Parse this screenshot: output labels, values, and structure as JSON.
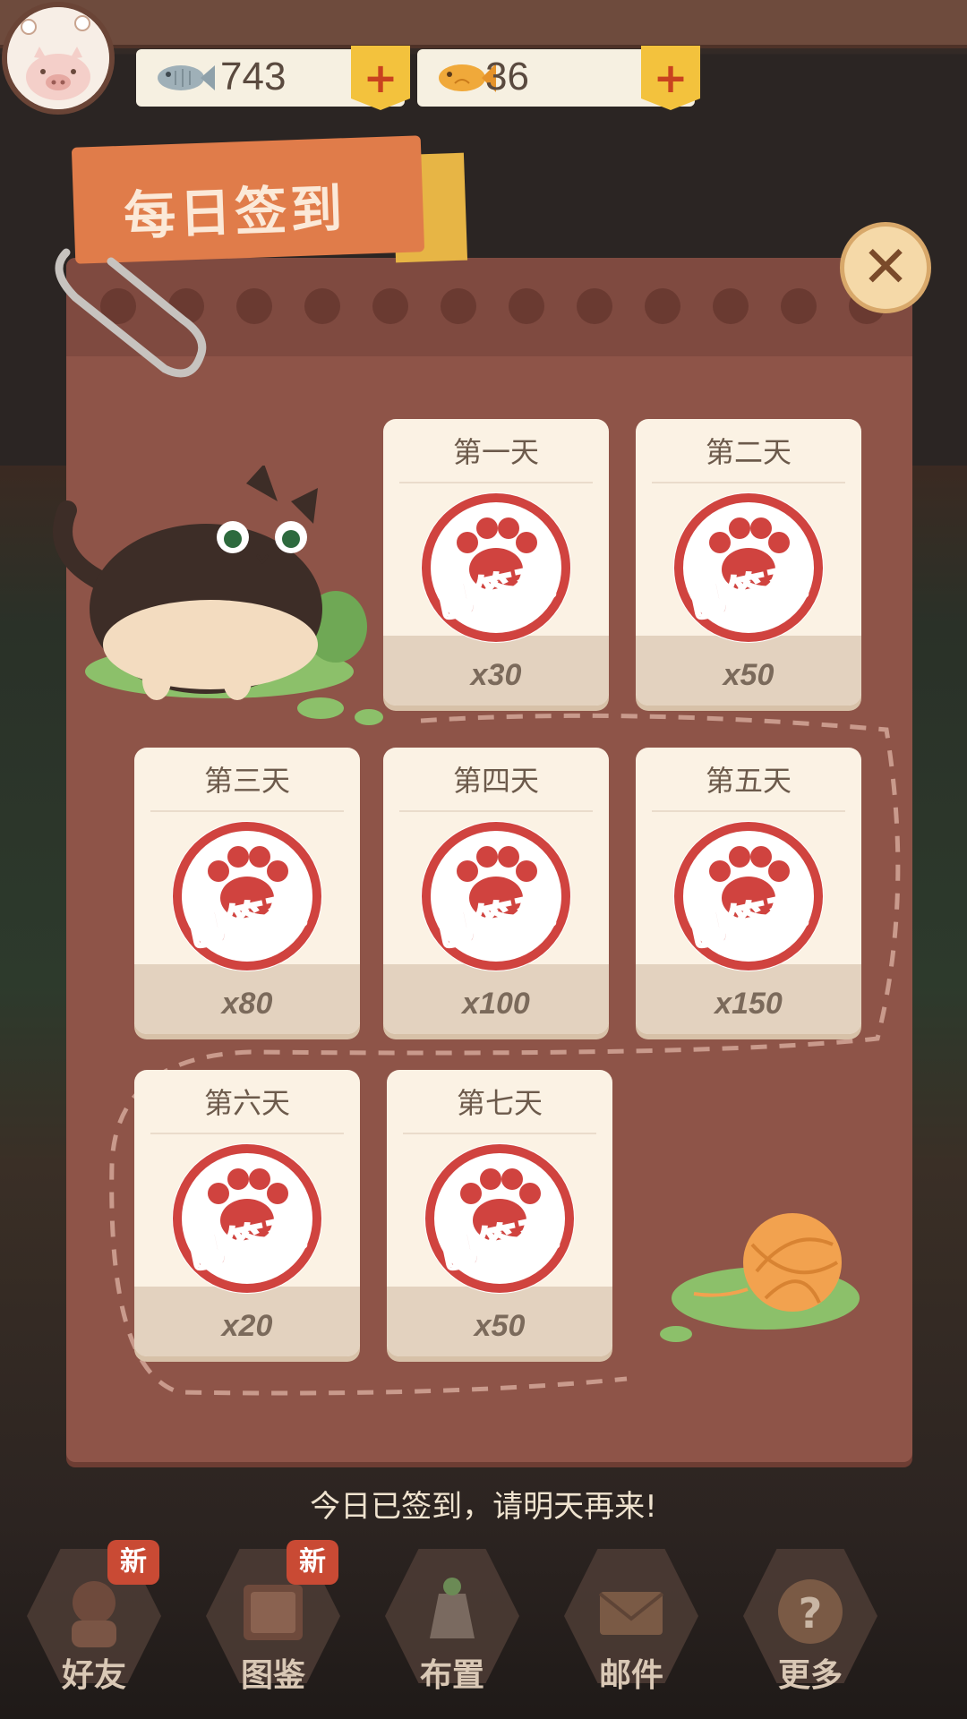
{
  "header": {
    "fish_silver": "743",
    "fish_gold": "36",
    "plus_label": "+",
    "plus_label_2": "+"
  },
  "title": "每日签到",
  "close_label": "✕",
  "stamp_text": "已签到",
  "days": [
    {
      "label": "第一天",
      "amount": "x30"
    },
    {
      "label": "第二天",
      "amount": "x50"
    },
    {
      "label": "第三天",
      "amount": "x80"
    },
    {
      "label": "第四天",
      "amount": "x100"
    },
    {
      "label": "第五天",
      "amount": "x150"
    },
    {
      "label": "第六天",
      "amount": "x20"
    },
    {
      "label": "第七天",
      "amount": "x50"
    }
  ],
  "message": "今日已签到，请明天再来!",
  "nav": {
    "items": [
      {
        "label": "好友",
        "badge": "新"
      },
      {
        "label": "图鉴",
        "badge": "新"
      },
      {
        "label": "布置"
      },
      {
        "label": "邮件"
      },
      {
        "label": "更多"
      }
    ]
  },
  "colors": {
    "panel": "#8e5448",
    "stamp_red": "#d0433f",
    "card": "#fbf2e4",
    "accent_yellow": "#f3c23d"
  }
}
